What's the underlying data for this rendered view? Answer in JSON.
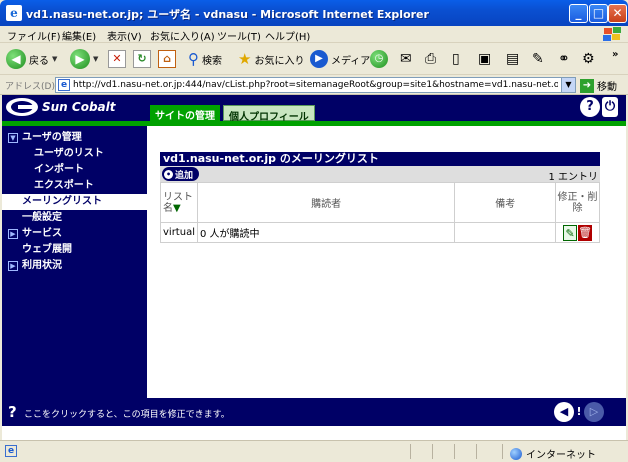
{
  "window": {
    "title": "vd1.nasu-net.or.jp; ユーザ名 - vdnasu - Microsoft Internet Explorer",
    "app_icon": "e",
    "min": "_",
    "max": "□",
    "close": "✕"
  },
  "menu": [
    "ファイル(F)",
    "編集(E)",
    "表示(V)",
    "お気に入り(A)",
    "ツール(T)",
    "ヘルプ(H)"
  ],
  "toolbar": {
    "back_label": "戻る",
    "search_label": "検索",
    "favorites_label": "お気に入り",
    "media_label": "メディア"
  },
  "address": {
    "label": "アドレス(D)",
    "url": "http://vd1.nasu-net.or.jp:444/nav/cList.php?root=sitemanageRoot&group=site1&hostname=vd1.nasu-net.or.jp&goto=base_",
    "go_label": "移動"
  },
  "header": {
    "logo_text": "Sun Cobalt",
    "tabs": [
      {
        "label": "サイトの管理",
        "active": true
      },
      {
        "label": "個人プロフィール",
        "active": false
      }
    ],
    "help": "?",
    "logout": "⏻"
  },
  "sidebar": {
    "items": [
      {
        "label": "ユーザの管理",
        "level": 1,
        "expanded": true
      },
      {
        "label": "ユーザのリスト",
        "level": 2
      },
      {
        "label": "インポート",
        "level": 2
      },
      {
        "label": "エクスポート",
        "level": 2
      },
      {
        "label": "メーリングリスト",
        "level": 1,
        "selected": true
      },
      {
        "label": "一般設定",
        "level": 1
      },
      {
        "label": "サービス",
        "level": 1,
        "expanded": false
      },
      {
        "label": "ウェブ展開",
        "level": 1
      },
      {
        "label": "利用状況",
        "level": 1,
        "expanded": false
      }
    ]
  },
  "list": {
    "title": "vd1.nasu-net.or.jp のメーリングリスト",
    "add_label": "追加",
    "count": "1 エントリ",
    "columns": {
      "name": "リスト名",
      "sort_indicator": "▼",
      "subscribers": "購読者",
      "note": "備考",
      "actions": "修正・削除"
    },
    "rows": [
      {
        "name": "virtual",
        "subscribers": "0 人が購読中",
        "note": ""
      }
    ]
  },
  "footer": {
    "help_icon": "?",
    "message": "ここをクリックすると、この項目を修正できます。"
  },
  "status": {
    "zone": "インターネット"
  }
}
